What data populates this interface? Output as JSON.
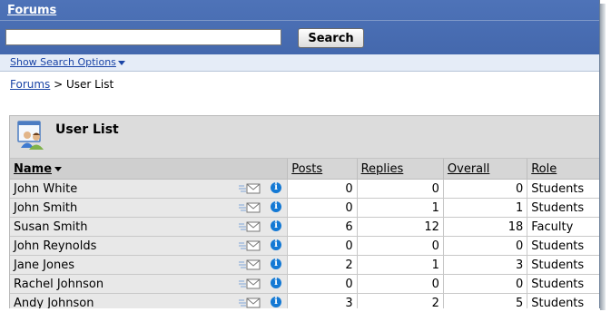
{
  "header": {
    "title": "Forums"
  },
  "search": {
    "value": "",
    "button_label": "Search"
  },
  "options": {
    "link_label": "Show Search Options"
  },
  "breadcrumb": {
    "root": "Forums",
    "separator": ">",
    "current": "User List"
  },
  "panel": {
    "title": "User List"
  },
  "table": {
    "columns": {
      "name": "Name",
      "posts": "Posts",
      "replies": "Replies",
      "overall": "Overall",
      "role": "Role"
    },
    "rows": [
      {
        "name": "John White",
        "posts": "0",
        "replies": "0",
        "overall": "0",
        "role": "Students"
      },
      {
        "name": "John Smith",
        "posts": "0",
        "replies": "1",
        "overall": "1",
        "role": "Students"
      },
      {
        "name": "Susan Smith",
        "posts": "6",
        "replies": "12",
        "overall": "18",
        "role": "Faculty"
      },
      {
        "name": "John Reynolds",
        "posts": "0",
        "replies": "0",
        "overall": "0",
        "role": "Students"
      },
      {
        "name": "Jane Jones",
        "posts": "2",
        "replies": "1",
        "overall": "3",
        "role": "Students"
      },
      {
        "name": "Rachel Johnson",
        "posts": "0",
        "replies": "0",
        "overall": "0",
        "role": "Students"
      },
      {
        "name": "Andy Johnson",
        "posts": "3",
        "replies": "2",
        "overall": "5",
        "role": "Students"
      }
    ]
  },
  "icons": {
    "mail": "send-mail-icon",
    "info": "info-icon",
    "users": "user-list-icon"
  },
  "colors": {
    "header": "#4a6fb4",
    "link": "#1a44a6",
    "info": "#1479d4"
  }
}
